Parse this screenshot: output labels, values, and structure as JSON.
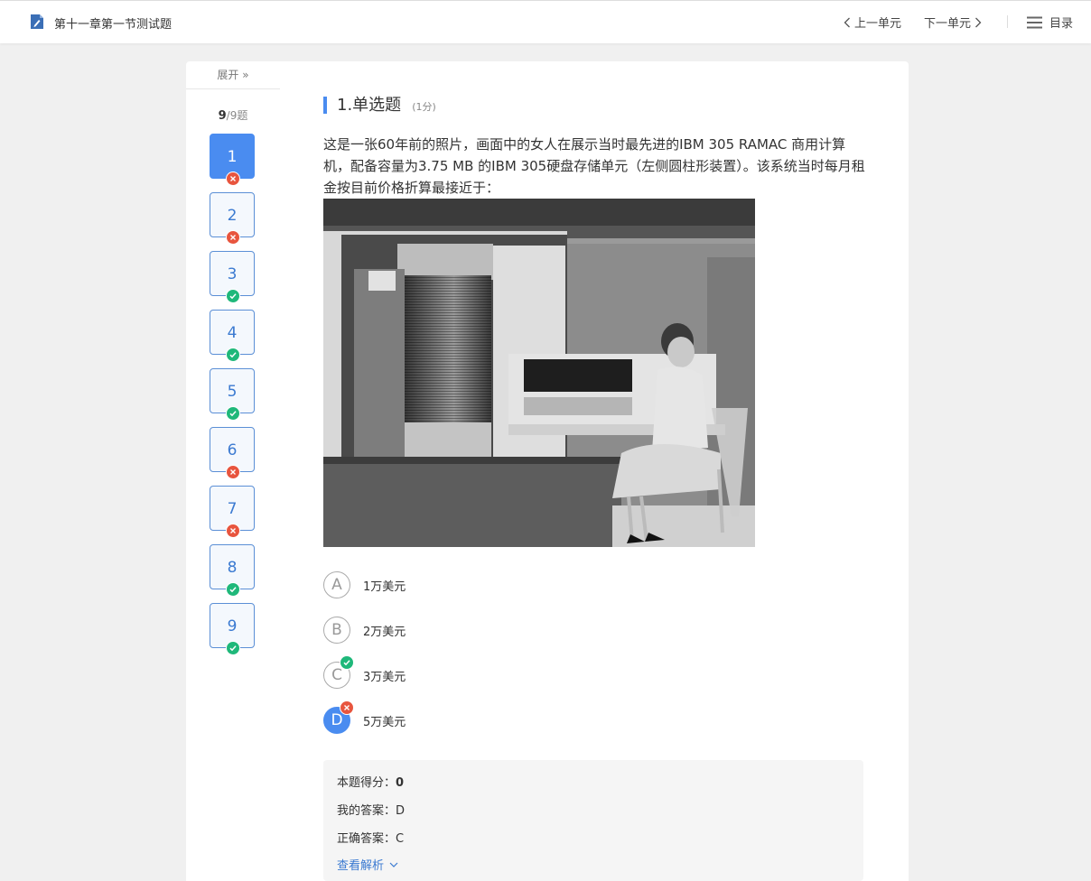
{
  "header": {
    "title": "第十一章第一节测试题",
    "prev_label": "上一单元",
    "next_label": "下一单元",
    "toc_label": "目录"
  },
  "sidebar": {
    "expand_label": "展开",
    "count_current": "9",
    "count_total": "/9题",
    "questions": [
      {
        "num": "1",
        "status": "wrong",
        "active": true
      },
      {
        "num": "2",
        "status": "wrong"
      },
      {
        "num": "3",
        "status": "right"
      },
      {
        "num": "4",
        "status": "right"
      },
      {
        "num": "5",
        "status": "right"
      },
      {
        "num": "6",
        "status": "wrong"
      },
      {
        "num": "7",
        "status": "wrong"
      },
      {
        "num": "8",
        "status": "right"
      },
      {
        "num": "9",
        "status": "right"
      }
    ]
  },
  "question": {
    "title": "1.单选题",
    "score": "(1分)",
    "stem": "这是一张60年前的照片，画面中的女人在展示当时最先进的IBM 305 RAMAC 商用计算机，配备容量为3.75 MB 的IBM 305硬盘存储单元（左侧圆柱形装置）。该系统当时每月租金按目前价格折算最接近于：",
    "options": [
      {
        "letter": "A",
        "text": "1万美元"
      },
      {
        "letter": "B",
        "text": "2万美元"
      },
      {
        "letter": "C",
        "text": "3万美元"
      },
      {
        "letter": "D",
        "text": "5万美元"
      }
    ]
  },
  "result": {
    "score_label": "本题得分：",
    "score_value": "0",
    "my_answer_label": "我的答案：",
    "my_answer_value": "D",
    "correct_label": "正确答案：",
    "correct_value": "C",
    "analysis_label": "查看解析"
  },
  "colors": {
    "accent": "#4a8cf0",
    "right": "#1fb87a",
    "wrong": "#e8553e"
  }
}
